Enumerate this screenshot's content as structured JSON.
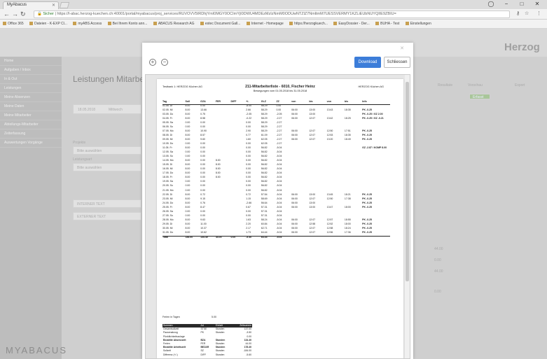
{
  "browser": {
    "tab_title": "MyAbacus",
    "url_secure": "Sicher",
    "url": "https://l-abac.herzog-kuechen.ch:40001/portal/myabacus/proj_services/RUVOVV5IRDhjYmI0MGY0OCImYjI0DWU4MDEzMzIzNmM0ODUwNTZlZ7NmltmM7UESSVERMY1KZLiEUbNUYQIIE9ZBIU=",
    "bookmarks": [
      "Office 365",
      "Dateien - K-EXP Cl...",
      "myABS Access",
      "Bei Ihrem Konto ann...",
      "ABACUS Research AG",
      "estec Document Gall...",
      "Internet - Homepage",
      "https://herzogkuech...",
      "EasyDossier - Der...",
      "BUHA - Test",
      "Einstellungen"
    ]
  },
  "app": {
    "brand": "Herzog",
    "logo": "MYABACUS",
    "page_title": "Leistungen Mitarbeiter",
    "sidebar": [
      "Home",
      "Aufgaben / Inbox",
      "In & Out",
      "Leistungen",
      "Meine Absenzen",
      "Meine Daten",
      "Meine Mitarbeiter",
      "Abteilungs-Mitarbeiter",
      "Zeiterfassung",
      "Auswertungen Vorgänge"
    ],
    "date_field": "18.05.2018",
    "day_field": "Mittwoch",
    "label_project": "Projekte",
    "label_leistung": "Leistungsart",
    "placeholder": "Bitte auswählen",
    "section_intern": "INTERNER TEXT",
    "section_extern": "EXTERNER TEXT",
    "tab_resultate": "Resultate",
    "tab_vorschau": "Vorschau",
    "tab_export": "Export",
    "status": "Erfasst",
    "right_values": [
      "44.00",
      "0.00",
      "44.00",
      "0.00"
    ]
  },
  "modal": {
    "download_label": "Download",
    "close_label": "Schliessen",
    "zoom_in": "+",
    "zoom_out": "−",
    "report": {
      "header_left": "Testbank 1: HERZOG Küchen AG",
      "header_right": "HERZOG Küchen AG",
      "title": "211-Mitarbeiterliste - 6010, Fischer Heinz",
      "subtitle": "Bewegungen vom 01.05.2018 bis 31.05.2018",
      "columns": [
        "Tag",
        "Soll",
        "GZA",
        "FER",
        "DIFF",
        "+/-",
        "GLZ",
        "ZZ",
        "von",
        "bis",
        "von",
        "bis",
        "Info"
      ],
      "rows": [
        [
          "01.05. Di",
          "8.00",
          "0.00",
          "",
          "",
          "-8.00",
          "58.29",
          "0.00",
          "",
          "",
          "",
          "",
          ""
        ],
        [
          "02.05. Mi",
          "8.00",
          "13.66",
          "",
          "",
          "2.66",
          "58.29",
          "0.00",
          "06:00",
          "13:00",
          "13:43",
          "18:35",
          "PK -0.25"
        ],
        [
          "03.05. Do",
          "8.00",
          "0.75",
          "",
          "",
          "-2.05",
          "58.29",
          "-2.05",
          "06:00",
          "13:00",
          "",
          "",
          "PK -0.25 / GZ 2.00"
        ],
        [
          "04.05. Fr",
          "8.00",
          "8.58",
          "",
          "",
          "-0.22",
          "58.29",
          "-2.27",
          "06:00",
          "12:07",
          "13:42",
          "18:25",
          "PK -0.25 / GZ -0.21"
        ],
        [
          "05.05. Sa",
          "0.00",
          "0.00",
          "",
          "",
          "0.00",
          "58.29",
          "-2.27",
          "",
          "",
          "",
          "",
          ""
        ],
        [
          "06.05. So",
          "0.00",
          "0.00",
          "",
          "",
          "0.00",
          "58.29",
          "-2.27",
          "",
          "",
          "",
          "",
          ""
        ],
        [
          "07.05. Mo",
          "8.00",
          "10.90",
          "",
          "",
          "2.90",
          "58.29",
          "-2.27",
          "06:00",
          "12:07",
          "12:50",
          "17:51",
          "PK -0.25"
        ],
        [
          "08.05. Di",
          "8.00",
          "8.57",
          "",
          "",
          "0.77",
          "61.09",
          "-2.27",
          "06:00",
          "12:07",
          "12:53",
          "18:35",
          "PK -0.25"
        ],
        [
          "09.05. Mi",
          "8.00",
          "9.60",
          "",
          "",
          "1.60",
          "62.05",
          "-2.27",
          "06:00",
          "12:07",
          "13:20",
          "18:49",
          "PK -0.25"
        ],
        [
          "10.05. Do",
          "0.00",
          "0.00",
          "",
          "",
          "0.00",
          "62.05",
          "-2.27",
          "",
          "",
          "",
          "",
          ""
        ],
        [
          "11.05. Fr",
          "8.00",
          "0.00",
          "",
          "",
          "0.00",
          "56.82",
          "-5.04",
          "",
          "",
          "",
          "",
          "GZ -2.87 / KOMP 8.00"
        ],
        [
          "12.05. Sa",
          "0.00",
          "0.00",
          "",
          "",
          "0.00",
          "56.82",
          "-5.04",
          "",
          "",
          "",
          "",
          ""
        ],
        [
          "13.05. So",
          "0.00",
          "0.00",
          "",
          "",
          "0.00",
          "56.82",
          "-5.04",
          "",
          "",
          "",
          "",
          ""
        ],
        [
          "14.05. Mo",
          "8.00",
          "0.00",
          "8.00",
          "",
          "0.00",
          "56.82",
          "-5.04",
          "",
          "",
          "",
          "",
          ""
        ],
        [
          "15.05. Di",
          "8.00",
          "0.00",
          "8.00",
          "",
          "0.00",
          "56.82",
          "-5.04",
          "",
          "",
          "",
          "",
          ""
        ],
        [
          "16.05. Mi",
          "8.00",
          "0.00",
          "8.00",
          "",
          "0.00",
          "56.82",
          "-5.04",
          "",
          "",
          "",
          "",
          ""
        ],
        [
          "17.05. Do",
          "8.00",
          "0.00",
          "8.00",
          "",
          "0.00",
          "56.82",
          "-5.04",
          "",
          "",
          "",
          "",
          ""
        ],
        [
          "18.05. Fr",
          "8.00",
          "0.00",
          "8.00",
          "",
          "0.00",
          "56.82",
          "-5.04",
          "",
          "",
          "",
          "",
          ""
        ],
        [
          "19.05. Sa",
          "0.00",
          "0.00",
          "",
          "",
          "0.00",
          "56.82",
          "-5.04",
          "",
          "",
          "",
          "",
          ""
        ],
        [
          "20.05. So",
          "0.00",
          "0.00",
          "",
          "",
          "0.00",
          "56.82",
          "-5.04",
          "",
          "",
          "",
          "",
          ""
        ],
        [
          "21.05. Mo",
          "0.00",
          "0.00",
          "",
          "",
          "0.00",
          "56.82",
          "-5.04",
          "",
          "",
          "",
          "",
          ""
        ],
        [
          "22.05. Di",
          "8.00",
          "0.72",
          "",
          "",
          "0.72",
          "57.54",
          "-5.04",
          "06:00",
          "13:00",
          "13:45",
          "18:21",
          "PK -0.25"
        ],
        [
          "23.05. Mi",
          "8.00",
          "9.15",
          "",
          "",
          "1.15",
          "58.69",
          "-5.04",
          "06:00",
          "12:07",
          "12:50",
          "17:38",
          "PK -0.25"
        ],
        [
          "24.05. Do",
          "8.00",
          "0.76",
          "",
          "",
          "-2.66",
          "56.64",
          "-5.04",
          "06:00",
          "13:00",
          "",
          "",
          "PK -0.25"
        ],
        [
          "25.05. Fr",
          "8.00",
          "8.47",
          "",
          "",
          "0.67",
          "57.31",
          "-5.04",
          "06:00",
          "13:00",
          "13:47",
          "18:00",
          "PK -0.25"
        ],
        [
          "26.05. Sa",
          "0.00",
          "0.00",
          "",
          "",
          "0.00",
          "57.31",
          "-5.04",
          "",
          "",
          "",
          "",
          ""
        ],
        [
          "27.05. So",
          "0.00",
          "0.00",
          "",
          "",
          "0.00",
          "57.31",
          "-5.04",
          "",
          "",
          "",
          "",
          ""
        ],
        [
          "28.05. Mo",
          "8.00",
          "9.63",
          "",
          "",
          "1.63",
          "58.24",
          "-5.04",
          "06:00",
          "12:07",
          "12:57",
          "18:55",
          "PK -0.25"
        ],
        [
          "29.05. Di",
          "8.00",
          "11.00",
          "",
          "",
          "2.20",
          "60.84",
          "-5.04",
          "06:00",
          "12:58",
          "12:52",
          "18:00",
          "PK -0.25"
        ],
        [
          "30.05. Mi",
          "8.00",
          "10.37",
          "",
          "",
          "2.17",
          "62.71",
          "-5.04",
          "06:00",
          "12:07",
          "12:58",
          "18:24",
          "PK -0.25"
        ],
        [
          "31.05. Do",
          "8.00",
          "10.62",
          "",
          "",
          "1.73",
          "64.44",
          "-5.04",
          "06:00",
          "12:07",
          "12:56",
          "17:36",
          "PK -0.25"
        ]
      ],
      "total": [
        "Total",
        "184.00",
        "134.40",
        "44.00",
        "0.00",
        "-5.40",
        "64.44",
        "-5.04",
        "",
        "",
        "",
        "",
        ""
      ],
      "ferien_label": "Ferien in Tagen",
      "ferien_value": "5.00",
      "summary_columns": [
        "Summen",
        "Art",
        "Einheit",
        "Zeitsumme"
      ],
      "summary": [
        [
          "Gesamtsollzeit",
          "STSE",
          "Stunden",
          "137.00"
        ],
        [
          "Pausenabzug",
          "PK",
          "Stunden",
          "-3.50"
        ],
        [
          "Pünktlichkeitszulage",
          "",
          "",
          "0.00"
        ],
        [
          "Bezahlte Absenzzeit",
          "BZA",
          "Stunden",
          "134.40"
        ],
        [
          "Ferien",
          "FER",
          "Stunden",
          "44.00"
        ],
        [
          "Bezahlte Arbeitszeit",
          "BEZAR",
          "Stunden",
          "178.40"
        ],
        [
          "Sollzeit",
          "SZ",
          "Stunden",
          "-184.00"
        ],
        [
          "Differenz (+/-)",
          "DIFF",
          "Stunden",
          "-5.60"
        ]
      ]
    }
  }
}
